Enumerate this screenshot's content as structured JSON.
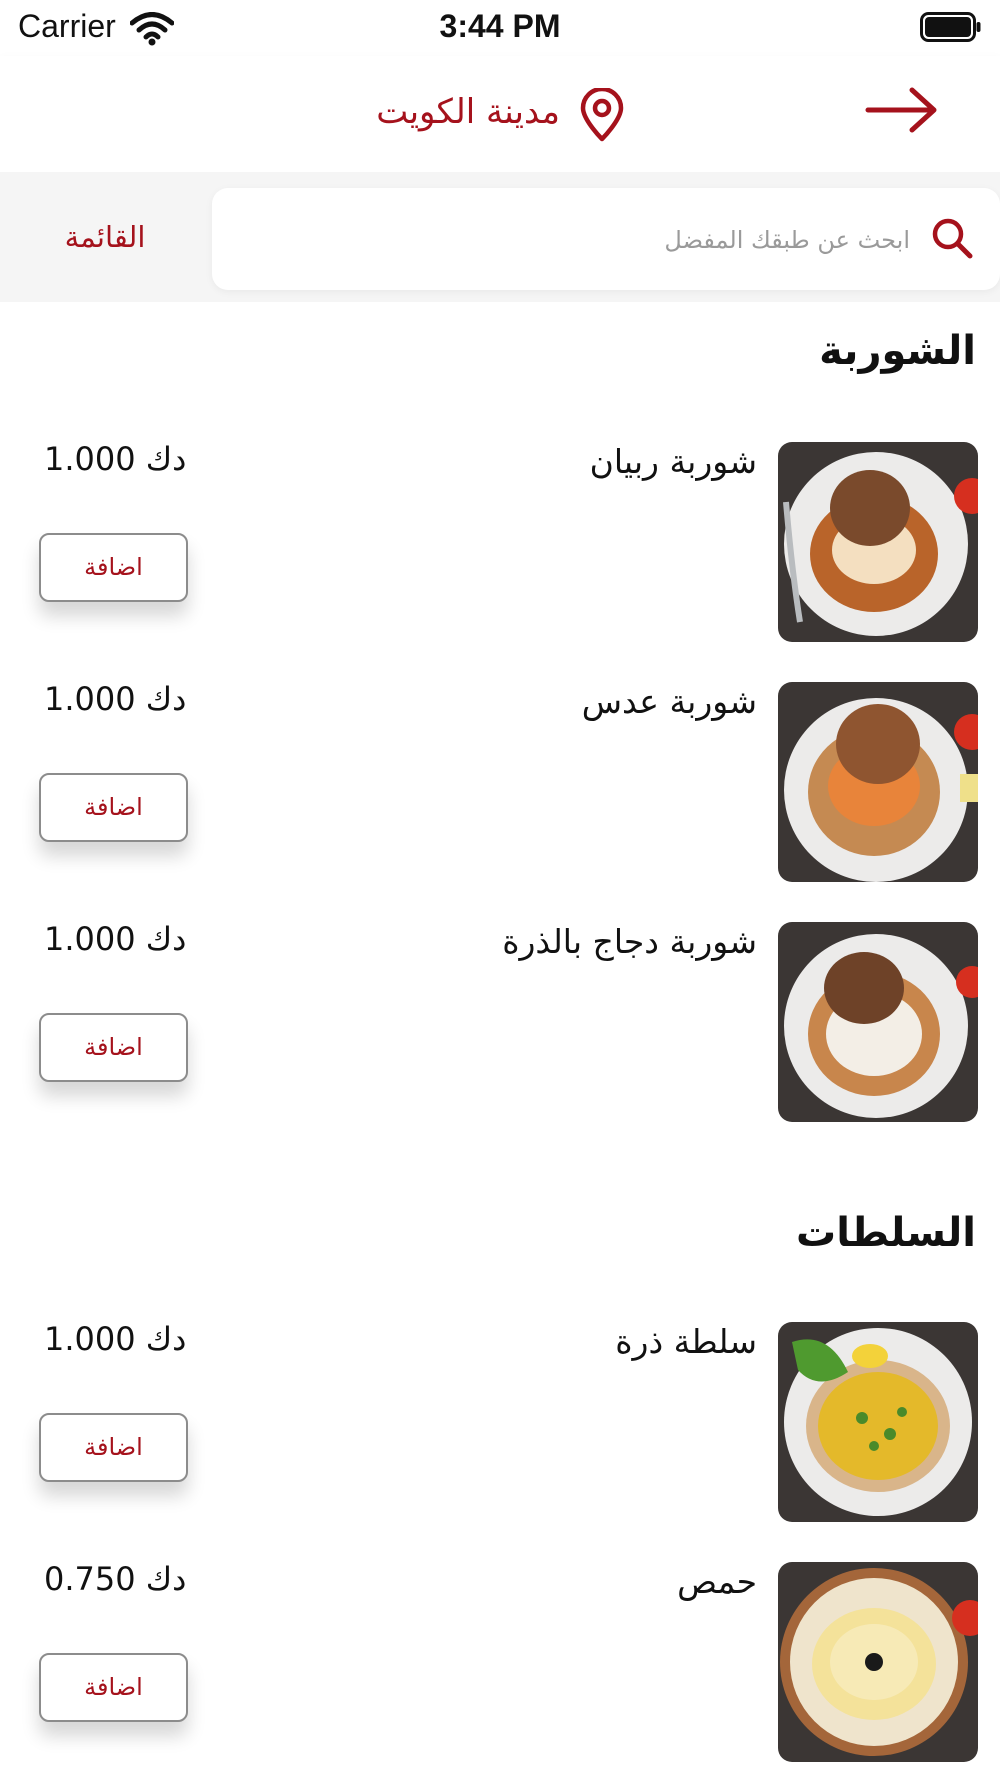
{
  "status_bar": {
    "carrier": "Carrier",
    "time": "3:44 PM"
  },
  "header": {
    "city": "مدينة الكويت",
    "back_icon": "arrow-right-icon",
    "pin_icon": "location-pin-icon"
  },
  "search": {
    "placeholder": "ابحث عن طبقك المفضل",
    "menu_label": "القائمة",
    "icon": "search-icon"
  },
  "colors": {
    "accent": "#a5121c"
  },
  "sections": [
    {
      "title": "الشوربة",
      "items": [
        {
          "name": "شوربة ربيان",
          "price": "1.000 دك",
          "add_label": "اضافة"
        },
        {
          "name": "شوربة عدس",
          "price": "1.000 دك",
          "add_label": "اضافة"
        },
        {
          "name": "شوربة دجاج بالذرة",
          "price": "1.000 دك",
          "add_label": "اضافة"
        }
      ]
    },
    {
      "title": "السلطات",
      "items": [
        {
          "name": "سلطة ذرة",
          "price": "1.000 دك",
          "add_label": "اضافة"
        },
        {
          "name": "حمص",
          "price": "0.750 دك",
          "add_label": "اضافة"
        }
      ]
    }
  ]
}
